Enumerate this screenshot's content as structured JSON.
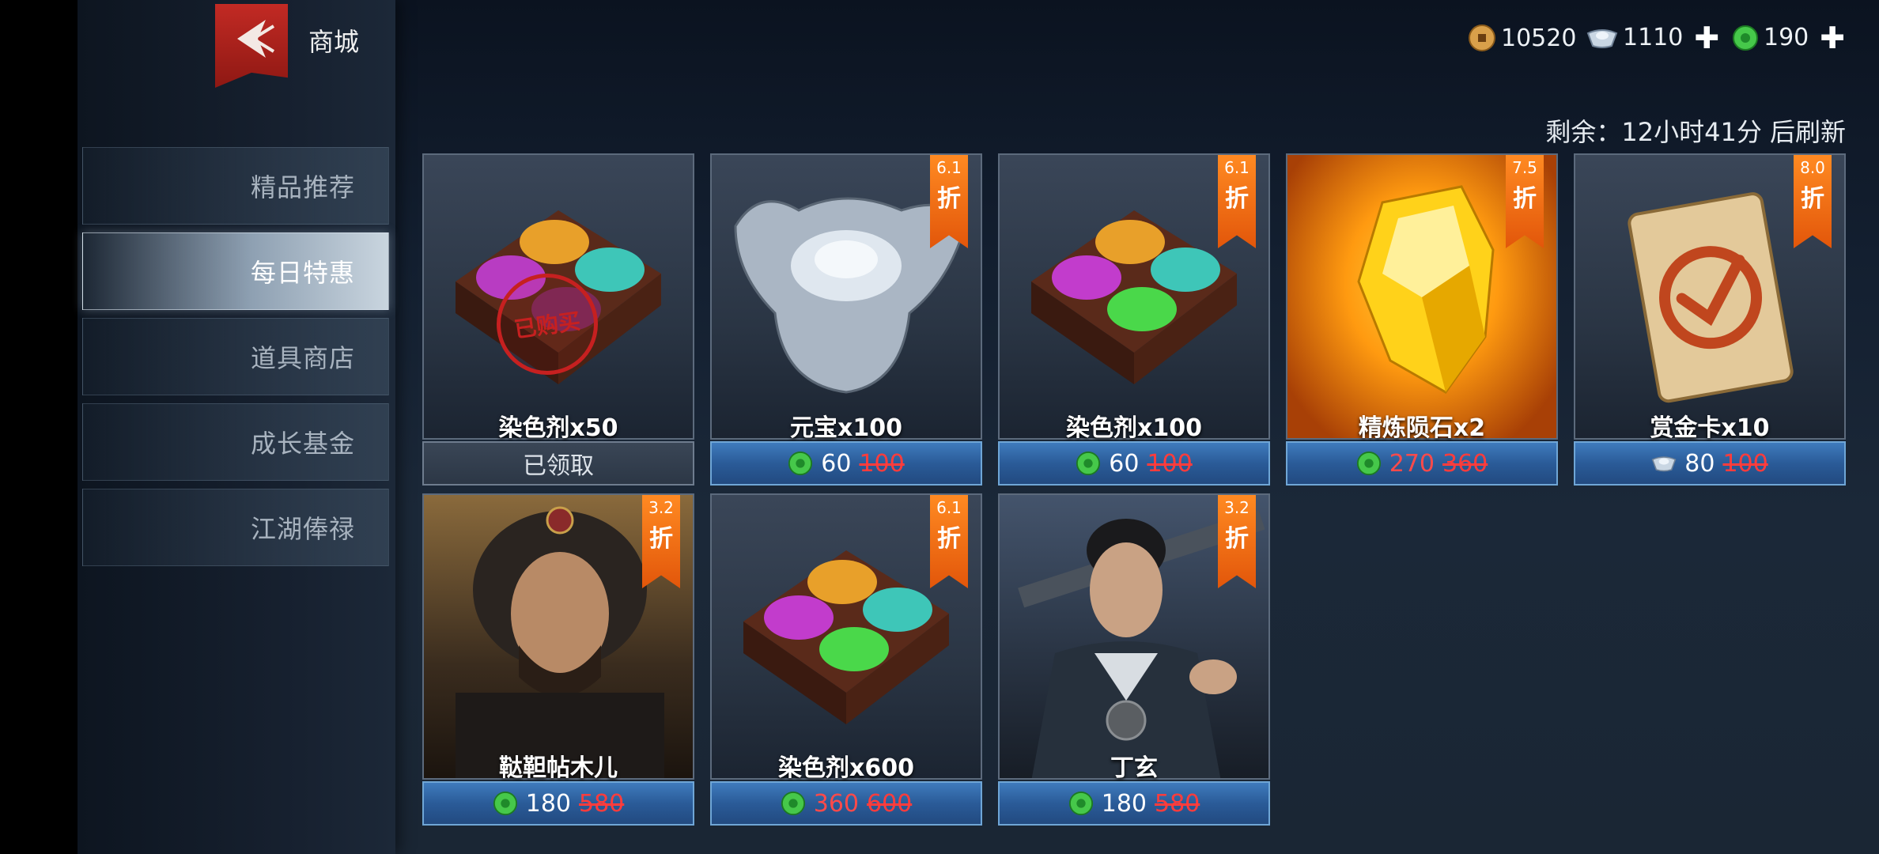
{
  "header": {
    "title": "商城"
  },
  "currencies": [
    {
      "icon": "copper-coin-icon",
      "value": "10520",
      "has_plus": false
    },
    {
      "icon": "silver-ingot-icon",
      "value": "1110",
      "has_plus": true
    },
    {
      "icon": "jade-gem-icon",
      "value": "190",
      "has_plus": true
    }
  ],
  "refresh": {
    "text": "剩余：12小时41分 后刷新"
  },
  "nav": {
    "items": [
      {
        "label": "精品推荐",
        "active": false
      },
      {
        "label": "每日特惠",
        "active": true
      },
      {
        "label": "道具商店",
        "active": false
      },
      {
        "label": "成长基金",
        "active": false
      },
      {
        "label": "江湖俸禄",
        "active": false
      }
    ]
  },
  "products": [
    {
      "name": "染色剂x50",
      "image": "dye-box-icon",
      "discount": null,
      "discount_char": null,
      "claimed": true,
      "claimed_label": "已领取",
      "stamp": "已购买"
    },
    {
      "name": "元宝x100",
      "image": "silver-ingot-icon",
      "discount": "6.1",
      "discount_char": "折",
      "currency": "jade-gem-icon",
      "price": "60",
      "old_price": "100",
      "price_red": false
    },
    {
      "name": "染色剂x100",
      "image": "dye-box-icon",
      "discount": "6.1",
      "discount_char": "折",
      "currency": "jade-gem-icon",
      "price": "60",
      "old_price": "100",
      "price_red": false
    },
    {
      "name": "精炼陨石x2",
      "image": "meteorite-crystal-icon",
      "discount": "7.5",
      "discount_char": "折",
      "currency": "jade-gem-icon",
      "price": "270",
      "old_price": "360",
      "price_red": true
    },
    {
      "name": "赏金卡x10",
      "image": "bounty-card-icon",
      "discount": "8.0",
      "discount_char": "折",
      "currency": "silver-ingot-icon",
      "price": "80",
      "old_price": "100",
      "price_red": false
    },
    {
      "name": "鞑靼帖木儿",
      "image": "hero-portrait-icon",
      "discount": "3.2",
      "discount_char": "折",
      "currency": "jade-gem-icon",
      "price": "180",
      "old_price": "580",
      "price_red": false
    },
    {
      "name": "染色剂x600",
      "image": "dye-box-icon",
      "discount": "6.1",
      "discount_char": "折",
      "currency": "jade-gem-icon",
      "price": "360",
      "old_price": "600",
      "price_red": true
    },
    {
      "name": "丁玄",
      "image": "hero-portrait-icon",
      "discount": "3.2",
      "discount_char": "折",
      "currency": "jade-gem-icon",
      "price": "180",
      "old_price": "580",
      "price_red": false
    }
  ],
  "colors": {
    "accent_red": "#c22a24",
    "price_bar_blue": "#2a5b98",
    "ribbon_orange": "#e2560a",
    "old_price_red": "#ff3c3c"
  }
}
